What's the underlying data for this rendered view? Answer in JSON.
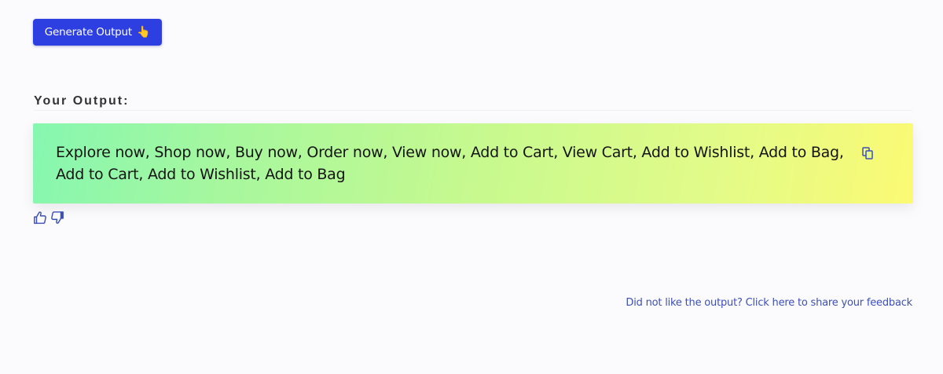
{
  "generate_button": {
    "label": "Generate Output",
    "icon": "pointing-hand-icon",
    "emoji": "👆",
    "color": "#2d3fe0"
  },
  "output_section": {
    "heading": "Your Output:",
    "text": "Explore now, Shop now, Buy now, Order now, View now, Add to Cart, View Cart, Add to Wishlist, Add to Bag, Add to Cart, Add to Wishlist, Add to Bag",
    "copy_icon": "copy-icon"
  },
  "feedback": {
    "thumbs_up_icon": "thumbs-up-icon",
    "thumbs_down_icon": "thumbs-down-icon",
    "link_text": "Did not like the output? Click here to share your feedback",
    "link_color": "#3d4fb8"
  }
}
